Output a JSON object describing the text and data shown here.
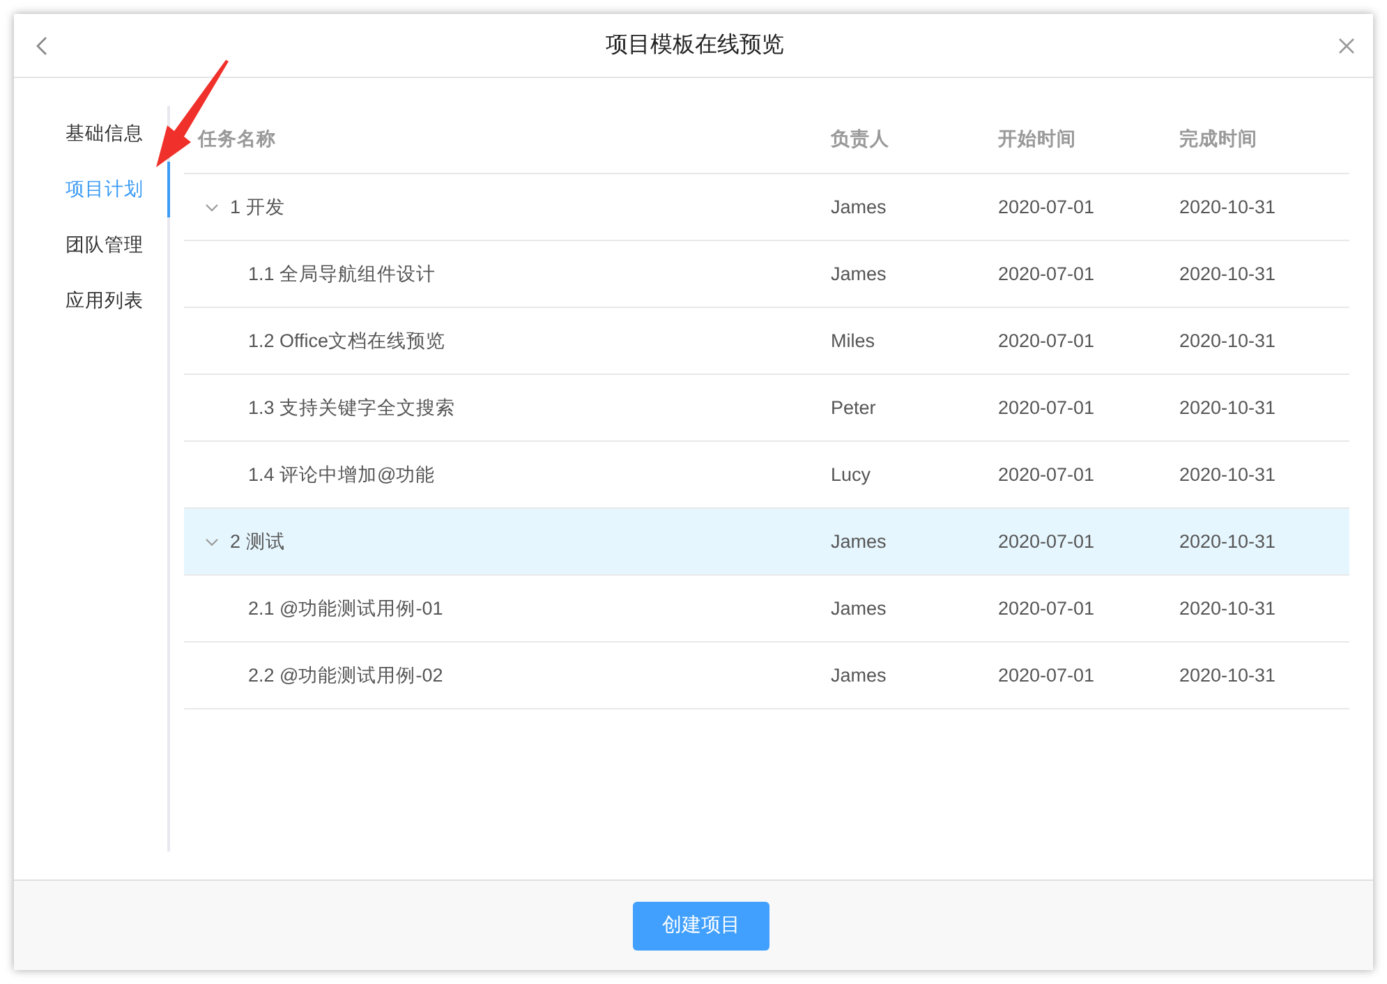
{
  "dialog": {
    "title": "项目模板在线预览"
  },
  "sidebar": {
    "items": [
      {
        "label": "基础信息",
        "selected": false
      },
      {
        "label": "项目计划",
        "selected": true
      },
      {
        "label": "团队管理",
        "selected": false
      },
      {
        "label": "应用列表",
        "selected": false
      }
    ]
  },
  "table": {
    "columns": [
      "任务名称",
      "负责人",
      "开始时间",
      "完成时间"
    ],
    "rows": [
      {
        "name": "1 开发",
        "owner": "James",
        "start": "2020-07-01",
        "end": "2020-10-31",
        "expanded": true,
        "selected": false,
        "children": [
          {
            "name": "1.1 全局导航组件设计",
            "owner": "James",
            "start": "2020-07-01",
            "end": "2020-10-31",
            "selected": false
          },
          {
            "name": "1.2 Office文档在线预览",
            "owner": "Miles",
            "start": "2020-07-01",
            "end": "2020-10-31",
            "selected": false
          },
          {
            "name": "1.3 支持关键字全文搜索",
            "owner": "Peter",
            "start": "2020-07-01",
            "end": "2020-10-31",
            "selected": false
          },
          {
            "name": "1.4 评论中增加@功能",
            "owner": "Lucy",
            "start": "2020-07-01",
            "end": "2020-10-31",
            "selected": false
          }
        ]
      },
      {
        "name": "2 测试",
        "owner": "James",
        "start": "2020-07-01",
        "end": "2020-10-31",
        "expanded": true,
        "selected": true,
        "children": [
          {
            "name": "2.1 @功能测试用例-01",
            "owner": "James",
            "start": "2020-07-01",
            "end": "2020-10-31",
            "selected": false
          },
          {
            "name": "2.2 @功能测试用例-02",
            "owner": "James",
            "start": "2020-07-01",
            "end": "2020-10-31",
            "selected": false
          }
        ]
      }
    ]
  },
  "footer": {
    "button": "创建项目"
  }
}
